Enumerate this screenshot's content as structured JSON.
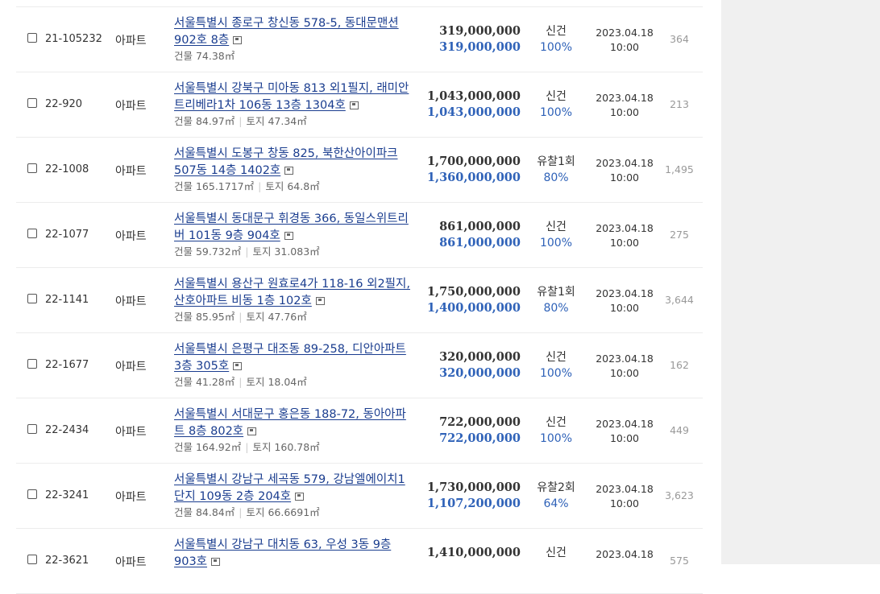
{
  "listings": [
    {
      "case_no": "21-105232",
      "type": "아파트",
      "address": "서울특별시 종로구 창신동 578-5, 동대문맨션 902호 8층",
      "building_area": "건물 74.38㎡",
      "land_area": "",
      "appraisal_price": "319,000,000",
      "minimum_price": "319,000,000",
      "status": "신건",
      "rate": "100%",
      "sale_date": "2023.04.18",
      "sale_time": "10:00",
      "views": "364"
    },
    {
      "case_no": "22-920",
      "type": "아파트",
      "address": "서울특별시 강북구 미아동 813 외1필지, 래미안트리베라1차 106동 13층 1304호",
      "building_area": "건물 84.97㎡",
      "land_area": "토지 47.34㎡",
      "appraisal_price": "1,043,000,000",
      "minimum_price": "1,043,000,000",
      "status": "신건",
      "rate": "100%",
      "sale_date": "2023.04.18",
      "sale_time": "10:00",
      "views": "213"
    },
    {
      "case_no": "22-1008",
      "type": "아파트",
      "address": "서울특별시 도봉구 창동 825, 북한산아이파크 507동 14층 1402호",
      "building_area": "건물 165.1717㎡",
      "land_area": "토지 64.8㎡",
      "appraisal_price": "1,700,000,000",
      "minimum_price": "1,360,000,000",
      "status": "유찰1회",
      "rate": "80%",
      "sale_date": "2023.04.18",
      "sale_time": "10:00",
      "views": "1,495"
    },
    {
      "case_no": "22-1077",
      "type": "아파트",
      "address": "서울특별시 동대문구 휘경동 366, 동일스위트리버 101동 9층 904호",
      "building_area": "건물 59.732㎡",
      "land_area": "토지 31.083㎡",
      "appraisal_price": "861,000,000",
      "minimum_price": "861,000,000",
      "status": "신건",
      "rate": "100%",
      "sale_date": "2023.04.18",
      "sale_time": "10:00",
      "views": "275"
    },
    {
      "case_no": "22-1141",
      "type": "아파트",
      "address": "서울특별시 용산구 원효로4가 118-16 외2필지, 산호아파트 비동 1층 102호",
      "building_area": "건물 85.95㎡",
      "land_area": "토지 47.76㎡",
      "appraisal_price": "1,750,000,000",
      "minimum_price": "1,400,000,000",
      "status": "유찰1회",
      "rate": "80%",
      "sale_date": "2023.04.18",
      "sale_time": "10:00",
      "views": "3,644"
    },
    {
      "case_no": "22-1677",
      "type": "아파트",
      "address": "서울특별시 은평구 대조동 89-258, 디안아파트 3층 305호",
      "building_area": "건물 41.28㎡",
      "land_area": "토지 18.04㎡",
      "appraisal_price": "320,000,000",
      "minimum_price": "320,000,000",
      "status": "신건",
      "rate": "100%",
      "sale_date": "2023.04.18",
      "sale_time": "10:00",
      "views": "162"
    },
    {
      "case_no": "22-2434",
      "type": "아파트",
      "address": "서울특별시 서대문구 홍은동 188-72, 동아아파트 8층 802호",
      "building_area": "건물 164.92㎡",
      "land_area": "토지 160.78㎡",
      "appraisal_price": "722,000,000",
      "minimum_price": "722,000,000",
      "status": "신건",
      "rate": "100%",
      "sale_date": "2023.04.18",
      "sale_time": "10:00",
      "views": "449"
    },
    {
      "case_no": "22-3241",
      "type": "아파트",
      "address": "서울특별시 강남구 세곡동 579, 강남엘에이치1단지 109동 2층 204호",
      "building_area": "건물 84.84㎡",
      "land_area": "토지 66.6691㎡",
      "appraisal_price": "1,730,000,000",
      "minimum_price": "1,107,200,000",
      "status": "유찰2회",
      "rate": "64%",
      "sale_date": "2023.04.18",
      "sale_time": "10:00",
      "views": "3,623"
    },
    {
      "case_no": "22-3621",
      "type": "아파트",
      "address": "서울특별시 강남구 대치동 63, 우성 3동 9층 903호",
      "building_area": "",
      "land_area": "",
      "appraisal_price": "1,410,000,000",
      "minimum_price": "",
      "status": "신건",
      "rate": "",
      "sale_date": "2023.04.18",
      "sale_time": "",
      "views": "575"
    }
  ]
}
